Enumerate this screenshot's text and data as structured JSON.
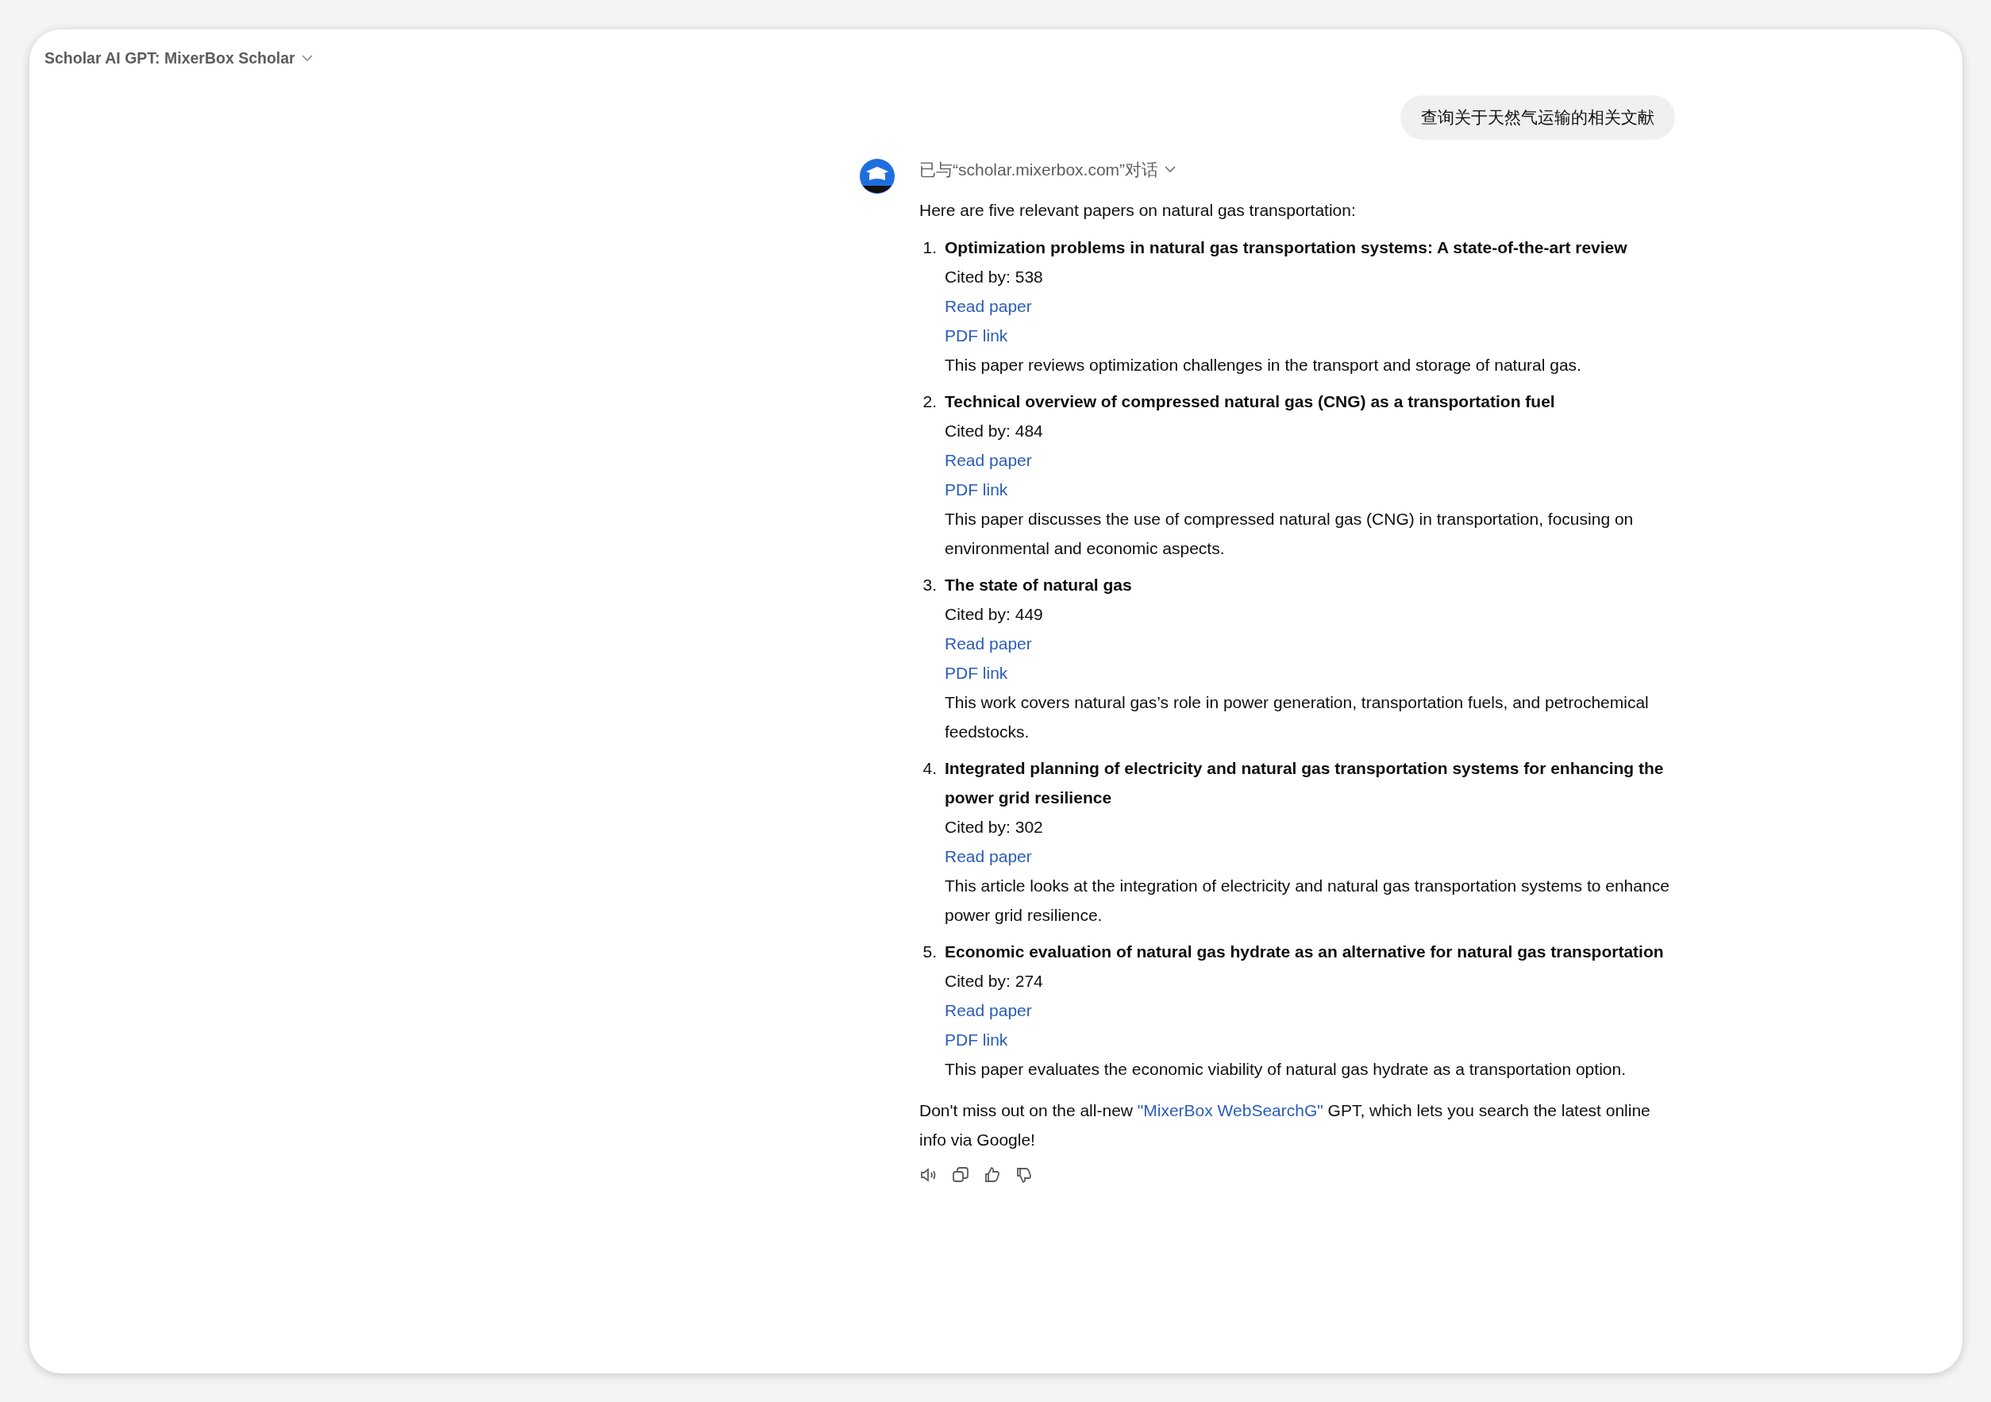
{
  "header": {
    "title": "Scholar AI GPT: MixerBox Scholar"
  },
  "user_message": "查询关于天然气运输的相关文献",
  "tool_status": "已与“scholar.mixerbox.com”对话",
  "intro": "Here are five relevant papers on natural gas transportation:",
  "papers": [
    {
      "number": "1.",
      "title": "Optimization problems in natural gas transportation systems: A state-of-the-art review",
      "cited": "Cited by: 538",
      "links": [
        "Read paper",
        "PDF link"
      ],
      "summary": "This paper reviews optimization challenges in the transport and storage of natural gas."
    },
    {
      "number": "2.",
      "title": "Technical overview of compressed natural gas (CNG) as a transportation fuel",
      "cited": "Cited by: 484",
      "links": [
        "Read paper",
        "PDF link"
      ],
      "summary": "This paper discusses the use of compressed natural gas (CNG) in transportation, focusing on environmental and economic aspects."
    },
    {
      "number": "3.",
      "title": "The state of natural gas",
      "cited": "Cited by: 449",
      "links": [
        "Read paper",
        "PDF link"
      ],
      "summary": "This work covers natural gas’s role in power generation, transportation fuels, and petrochemical feedstocks."
    },
    {
      "number": "4.",
      "title": "Integrated planning of electricity and natural gas transportation systems for enhancing the power grid resilience",
      "cited": "Cited by: 302",
      "links": [
        "Read paper"
      ],
      "summary": "This article looks at the integration of electricity and natural gas transportation systems to enhance power grid resilience."
    },
    {
      "number": "5.",
      "title": "Economic evaluation of natural gas hydrate as an alternative for natural gas transportation",
      "cited": "Cited by: 274",
      "links": [
        "Read paper",
        "PDF link"
      ],
      "summary": "This paper evaluates the economic viability of natural gas hydrate as a transportation option."
    }
  ],
  "footer": {
    "before": "Don't miss out on the all-new ",
    "link": "\"MixerBox WebSearchG\"",
    "after": " GPT, which lets you search the latest online info via Google!"
  }
}
